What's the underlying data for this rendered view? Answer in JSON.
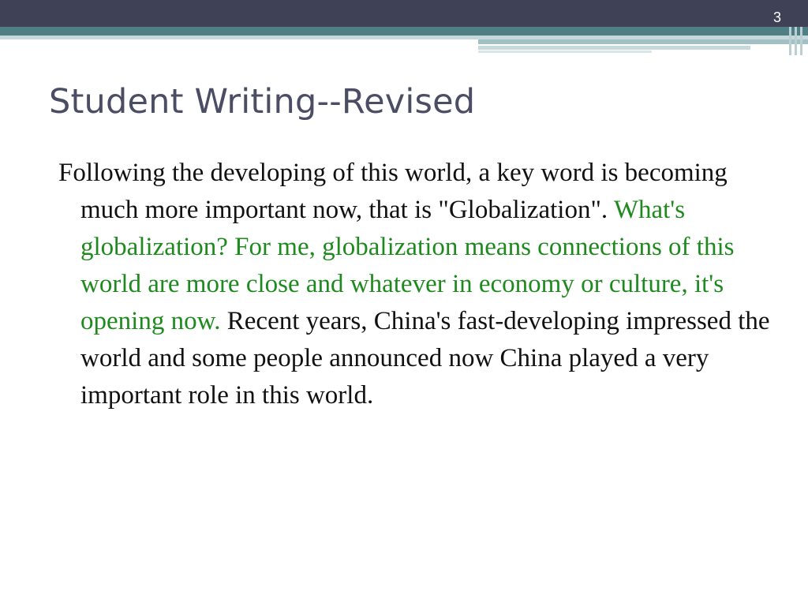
{
  "slide": {
    "number": "3",
    "title": "Student Writing--Revised",
    "paragraph": {
      "segment_1": "Following the developing of this world, a key word is becoming much more important now, that is \"Globalization\".",
      "segment_2": "What's globalization? For me, globalization means connections of this world are more close and whatever in economy or culture, it's opening now.",
      "segment_3": "Recent years, China's fast-developing impressed the world and some people announced now China played a very important role in this world."
    }
  },
  "colors": {
    "header_dark": "#3f4156",
    "header_teal": "#4f7f85",
    "title_text": "#4a4d63",
    "highlight_green": "#1e8a1e",
    "body_text": "#111111"
  }
}
